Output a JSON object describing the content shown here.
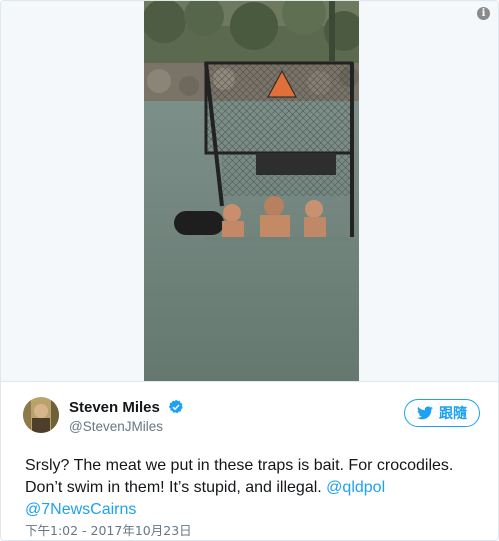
{
  "media": {
    "info_icon": "i",
    "photo_alt": "Three men in water inside a crocodile trap"
  },
  "tweet": {
    "author_name": "Steven Miles",
    "author_handle": "@StevenJMiles",
    "verified_icon": "verified-badge-icon",
    "follow_label": "跟隨",
    "text_before": "Srsly? The meat we put in these traps is bait. For crocodiles. Don’t swim in them! It’s stupid, and illegal. ",
    "mention_1": "@qldpol",
    "mention_2": "@7NewsCairns",
    "timestamp": "下午1:02 - 2017年10月23日"
  },
  "colors": {
    "accent": "#1da1f2",
    "text": "#14171a",
    "muted": "#657786",
    "border": "#e1e8ed"
  }
}
